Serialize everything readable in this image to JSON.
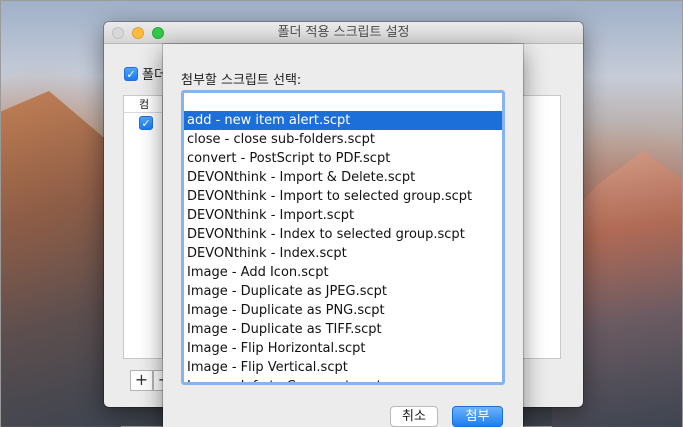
{
  "window": {
    "title": "폴더 적용 스크립트 설정",
    "enable_label": "폴더",
    "folders_header": "컴",
    "plus": "+",
    "minus": "−",
    "checkmark": "✓"
  },
  "sheet": {
    "label": "첨부할 스크립트 선택:",
    "selected_index": 0,
    "items": [
      "add - new item alert.scpt",
      "close - close sub-folders.scpt",
      "convert - PostScript to PDF.scpt",
      "DEVONthink - Import & Delete.scpt",
      "DEVONthink - Import to selected group.scpt",
      "DEVONthink - Import.scpt",
      "DEVONthink - Index to selected group.scpt",
      "DEVONthink - Index.scpt",
      "Image - Add Icon.scpt",
      "Image - Duplicate as JPEG.scpt",
      "Image - Duplicate as PNG.scpt",
      "Image - Duplicate as TIFF.scpt",
      "Image - Flip Horizontal.scpt",
      "Image - Flip Vertical.scpt",
      "Image - Info to Comment.scpt"
    ],
    "cancel_label": "취소",
    "attach_label": "첨부"
  },
  "colors": {
    "selection": "#1c6fd8",
    "accent": "#1d7ef2",
    "focus_ring": "#87b4ee"
  }
}
